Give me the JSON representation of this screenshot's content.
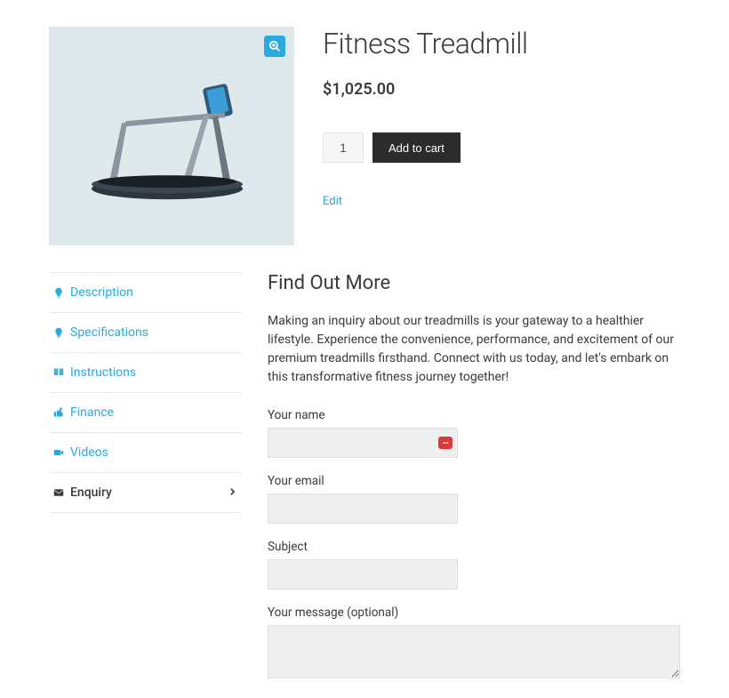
{
  "product": {
    "title": "Fitness Treadmill",
    "price": "$1,025.00",
    "quantity": "1",
    "add_to_cart_label": "Add to cart",
    "edit_label": "Edit"
  },
  "tabs": {
    "description": "Description",
    "specifications": "Specifications",
    "instructions": "Instructions",
    "finance": "Finance",
    "videos": "Videos",
    "enquiry": "Enquiry"
  },
  "enquiry_panel": {
    "title": "Find Out More",
    "description": "Making an inquiry about our treadmills is your gateway to a healthier lifestyle. Experience the convenience, performance, and excitement of our premium treadmills firsthand. Connect with us today, and let's embark on this transformative fitness journey together!",
    "name_label": "Your name",
    "email_label": "Your email",
    "subject_label": "Subject",
    "message_label": "Your message (optional)"
  }
}
